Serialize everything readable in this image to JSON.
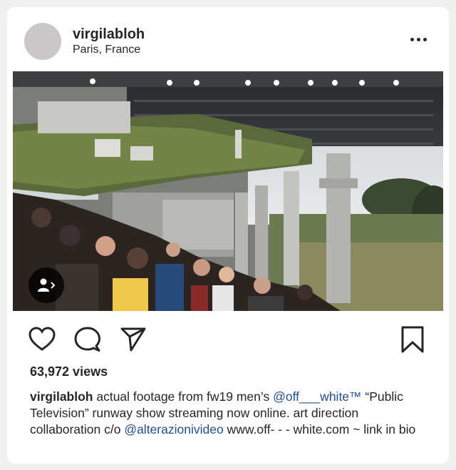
{
  "post": {
    "username": "virgilabloh",
    "location": "Paris, France",
    "views": "63,972 views",
    "caption": {
      "username": "virgilabloh",
      "text1": " actual footage from fw19 men’s ",
      "mention1": "@off___white™",
      "text2": " “Public Television” runway show streaming now online. art direction collaboration c/o ",
      "mention2": "@alterazionivideo",
      "text3": " www.off- - - white.com ~ link in bio"
    }
  },
  "icons": {
    "more": "more-options-icon",
    "like": "heart-icon",
    "comment": "comment-bubble-icon",
    "share": "paper-plane-icon",
    "save": "bookmark-icon",
    "tags": "user-tag-icon"
  },
  "colors": {
    "text": "#262626",
    "mention": "#1d4e9a",
    "avatar": "#c9c7c7"
  }
}
